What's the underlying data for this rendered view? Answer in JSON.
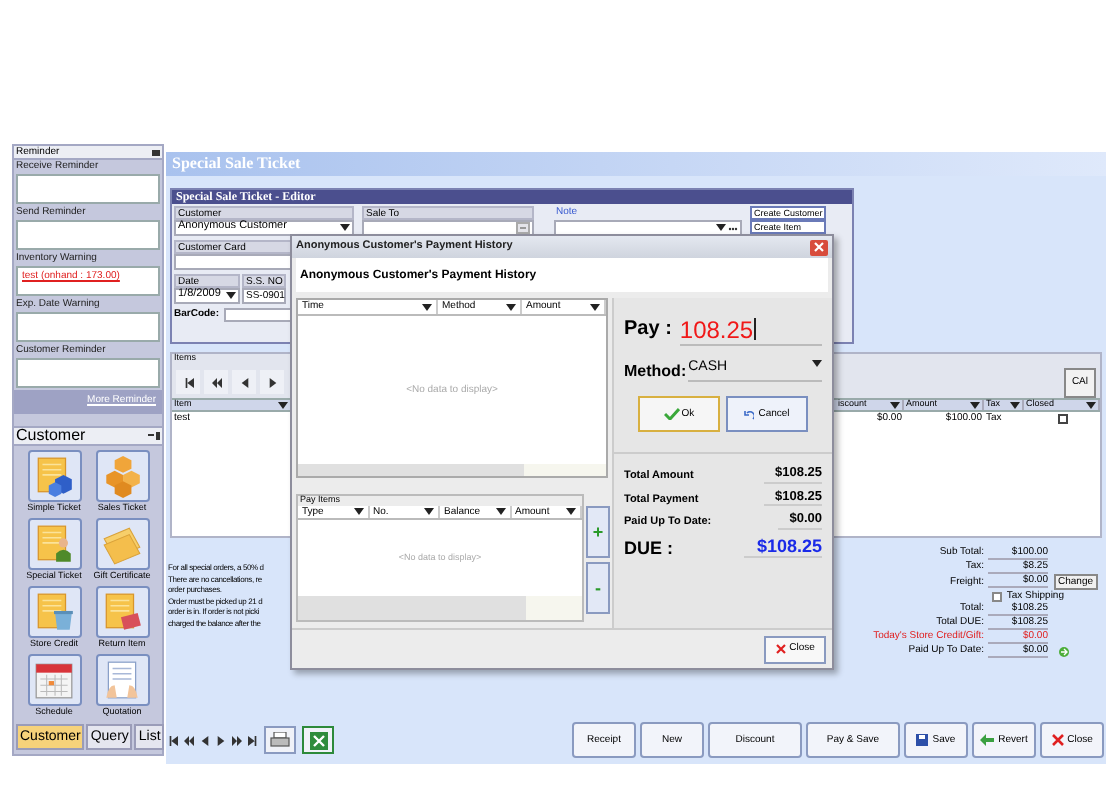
{
  "sidebar": {
    "reminder_title": "Reminder",
    "sections": [
      {
        "label": "Receive Reminder"
      },
      {
        "label": "Send Reminder"
      },
      {
        "label": "Inventory Warning",
        "entry": "test (onhand : 173.00)"
      },
      {
        "label": "Exp. Date Warning"
      },
      {
        "label": "Customer Reminder"
      }
    ],
    "more_link": "More Reminder",
    "panel_title": "Customer",
    "tiles": [
      {
        "label": "Simple Ticket",
        "kind": "simple"
      },
      {
        "label": "Sales Ticket",
        "kind": "sales"
      },
      {
        "label": "Special Ticket",
        "kind": "special"
      },
      {
        "label": "Gift Certificate",
        "kind": "gift"
      },
      {
        "label": "Store Credit",
        "kind": "credit"
      },
      {
        "label": "Return Item",
        "kind": "return"
      },
      {
        "label": "Schedule",
        "kind": "schedule"
      },
      {
        "label": "Quotation",
        "kind": "quotation"
      }
    ],
    "tabs": [
      {
        "label": "Customer",
        "selected": true
      },
      {
        "label": "Query",
        "selected": false
      },
      {
        "label": "List",
        "selected": false
      }
    ]
  },
  "ticket": {
    "title": "Special Sale Ticket",
    "editor": {
      "title": "Special Sale Ticket - Editor",
      "fields": [
        {
          "label": "Customer",
          "value": "Anonymous Customer",
          "kind": "combo"
        },
        {
          "label": "Sale To",
          "kind": "lookup"
        },
        {
          "label": "Note",
          "kind": "note"
        },
        {
          "label": "Customer Card",
          "kind": "text"
        },
        {
          "label": "Date",
          "value": "1/8/2009",
          "kind": "combo"
        },
        {
          "label": "S.S. NO",
          "value": "SS-0901",
          "kind": "text"
        },
        {
          "label": "BarCode:",
          "kind": "inline"
        }
      ],
      "buttons": [
        "Create Customer",
        "Create Item"
      ]
    },
    "items": {
      "title": "Items",
      "calc_button": "CAl",
      "columns": [
        "Item",
        "iscount",
        "Amount",
        "Tax",
        "Closed"
      ],
      "rows": [
        {
          "cells": [
            "test",
            "$0.00",
            "$100.00",
            "Tax"
          ],
          "closed": false
        }
      ]
    },
    "notes": [
      "For all special orders, a 50% d",
      "There are no cancellations, re",
      "order purchases.",
      "Order must be picked up 21 d",
      "order is in.  If order is not picki",
      "charged the balance after the"
    ],
    "totals": [
      {
        "kind": "value",
        "label": "Sub Total:",
        "value": "$100.00"
      },
      {
        "kind": "value",
        "label": "Tax:",
        "value": "$8.25"
      },
      {
        "kind": "button",
        "label": "Freight:",
        "value": "$0.00",
        "button": "Change"
      },
      {
        "kind": "checkbox",
        "label": "Tax Shipping",
        "checked": false
      },
      {
        "kind": "value",
        "label": "Total:",
        "value": "$108.25"
      },
      {
        "kind": "value",
        "label": "Total DUE:",
        "value": "$108.25"
      },
      {
        "kind": "alert",
        "label": "Today's Store Credit/Gift:",
        "value": "$0.00"
      },
      {
        "kind": "refresh",
        "label": "Paid Up To Date:",
        "value": "$0.00"
      }
    ],
    "buttons": [
      {
        "label": "Receipt",
        "kind": "plain"
      },
      {
        "label": "New",
        "kind": "plain"
      },
      {
        "label": "Discount",
        "kind": "plain"
      },
      {
        "label": "Pay & Save",
        "kind": "plain"
      },
      {
        "label": "Save",
        "kind": "save"
      },
      {
        "label": "Revert",
        "kind": "revert"
      },
      {
        "label": "Close",
        "kind": "close"
      }
    ]
  },
  "dialog": {
    "title": "Anonymous Customer's Payment History",
    "header": "Anonymous Customer's Payment History",
    "history_columns": [
      "Time",
      "Method",
      "Amount"
    ],
    "history_empty": "<No data to display>",
    "pay_items_title": "Pay Items",
    "pay_items_columns": [
      "Type",
      "No.",
      "Balance",
      "Amount"
    ],
    "pay_items_empty": "<No data to display>",
    "add_button": "+",
    "remove_button": "-",
    "pay": {
      "label": "Pay :",
      "value": "108.25"
    },
    "method": {
      "label": "Method:",
      "value": "CASH"
    },
    "ok_button": "Ok",
    "cancel_button": "Cancel",
    "summary": [
      {
        "kind": "amount",
        "label": "Total Amount",
        "value": "$108.25"
      },
      {
        "kind": "amount",
        "label": "Total Payment",
        "value": "$108.25"
      },
      {
        "kind": "amount",
        "label": "Paid Up To Date:",
        "value": "$0.00"
      },
      {
        "kind": "due",
        "label": "DUE :",
        "value": "$108.25"
      }
    ],
    "close_button": "Close"
  }
}
